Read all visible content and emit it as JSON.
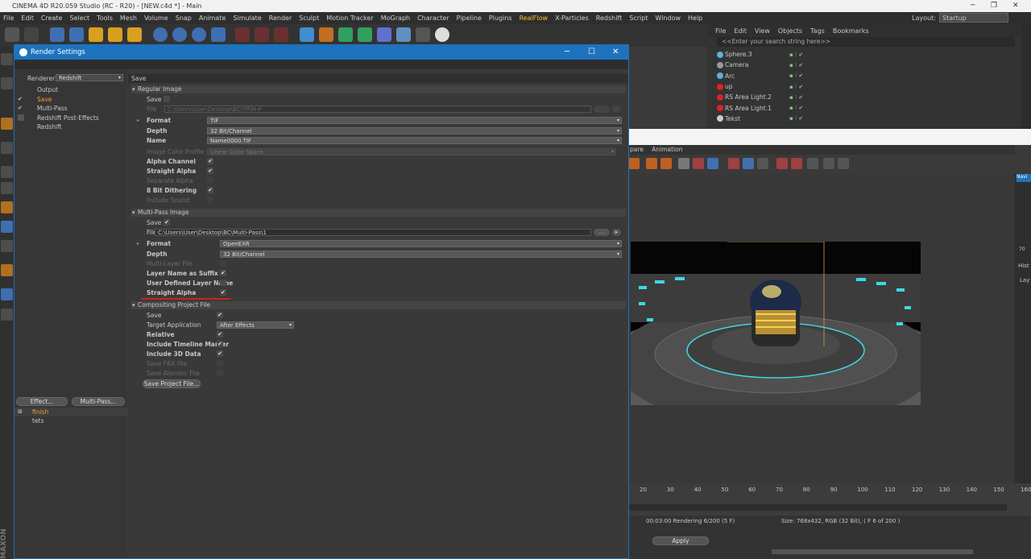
{
  "app": {
    "window_title": "CINEMA 4D R20.059 Studio (RC - R20) - [NEW.c4d *] - Main",
    "menu": [
      "File",
      "Edit",
      "Create",
      "Select",
      "Tools",
      "Mesh",
      "Volume",
      "Snap",
      "Animate",
      "Simulate",
      "Render",
      "Sculpt",
      "Motion Tracker",
      "MoGraph",
      "Character",
      "Pipeline",
      "Plugins",
      "RealFlow",
      "X-Particles",
      "Redshift",
      "Script",
      "Window",
      "Help"
    ],
    "highlight_menu": "RealFlow",
    "layout_label": "Layout:",
    "layout_value": "Startup"
  },
  "object_manager": {
    "menu": [
      "File",
      "Edit",
      "View",
      "Objects",
      "Tags",
      "Bookmarks"
    ],
    "search_placeholder": "<<Enter your search string here>>",
    "objects": [
      {
        "name": "Sphere.3",
        "color": "#5ab0e0"
      },
      {
        "name": "Camera",
        "color": "#9a9a9a"
      },
      {
        "name": "Arc",
        "color": "#5ab0e0"
      },
      {
        "name": "up",
        "color": "#e02020"
      },
      {
        "name": "RS Area Light.2",
        "color": "#e02020"
      },
      {
        "name": "RS Area Light.1",
        "color": "#e02020"
      },
      {
        "name": "Tekst",
        "color": "#cccccc"
      }
    ]
  },
  "picture_viewer": {
    "menu": [
      "pare",
      "Animation"
    ],
    "status_text": "00:03:00 Rendering 6/200 (5 F)",
    "size_text": "Size: 768x432, RGB (32 Bit),  ( F 6 of 200 )",
    "apply_label": "Apply",
    "ruler": [
      "20",
      "30",
      "40",
      "50",
      "60",
      "70",
      "80",
      "90",
      "100",
      "110",
      "120",
      "130",
      "140",
      "150",
      "160"
    ],
    "right_tabs": [
      "Navi",
      "Hist",
      "Lay"
    ],
    "zoom_hint": "70"
  },
  "dialog": {
    "title": "Render Settings",
    "renderer_label": "Renderer",
    "renderer_value": "Redshift",
    "tree": [
      {
        "label": "Output",
        "checked": false,
        "active": false
      },
      {
        "label": "Save",
        "checked": true,
        "active": true
      },
      {
        "label": "Multi-Pass",
        "checked": true,
        "active": false
      },
      {
        "label": "Redshift Post-Effects",
        "checked": false,
        "active": false
      },
      {
        "label": "Redshift",
        "checked": false,
        "active": false
      }
    ],
    "effect_button": "Effect...",
    "multipass_button": "Multi-Pass...",
    "setups": [
      {
        "label": "finish",
        "active": true
      },
      {
        "label": "tets",
        "active": false
      }
    ],
    "panel_title": "Save",
    "regular_image": {
      "header": "Regular Image",
      "save_label": "Save",
      "file_label": "File",
      "file_path": "C:\\Users\\User\\Desktop\\BC\\Tif\\M-P",
      "format_label": "Format",
      "format_value": "TIF",
      "depth_label": "Depth",
      "depth_value": "32 Bit/Channel",
      "name_label": "Name",
      "name_value": "Name0000.TIF",
      "profile_label": "Image Color Profile",
      "profile_value": "Linear Color Space",
      "alpha_label": "Alpha Channel",
      "straight_label": "Straight Alpha",
      "separate_label": "Separate Alpha",
      "dither_label": "8 Bit Dithering",
      "sound_label": "Include Sound"
    },
    "multipass_image": {
      "header": "Multi-Pass Image",
      "save_label": "Save",
      "file_label": "File",
      "file_path": "C:\\Users\\User\\Desktop\\BC\\Multi-Pass\\1",
      "format_label": "Format",
      "format_value": "OpenEXR",
      "depth_label": "Depth",
      "depth_value": "32 Bit/Channel",
      "multilayer_label": "Multi-Layer File",
      "suffix_label": "Layer Name as Suffix",
      "userdef_label": "User Defined Layer Name",
      "straight_label": "Straight Alpha"
    },
    "compositing": {
      "header": "Compositing Project File",
      "save_label": "Save",
      "target_label": "Target Application",
      "target_value": "After Effects",
      "relative_label": "Relative",
      "timeline_label": "Include Timeline Marker",
      "data3d_label": "Include 3D Data",
      "fbx_label": "Save FBX File",
      "alembic_label": "Save Alembic File",
      "save_project_button": "Save Project File..."
    }
  },
  "colors": {
    "accent_blue": "#1e73be",
    "active_orange": "#f0a030",
    "underline_red": "#d02020"
  }
}
